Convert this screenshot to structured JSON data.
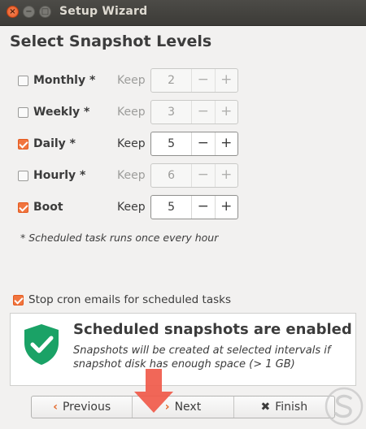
{
  "window": {
    "title": "Setup Wizard",
    "close_glyph": "×",
    "minimize_glyph": "−",
    "maximize_glyph": "□"
  },
  "page": {
    "title": "Select Snapshot Levels"
  },
  "levels": [
    {
      "label": "Monthly *",
      "checked": false,
      "keep_label": "Keep",
      "keep": "2",
      "enabled": false
    },
    {
      "label": "Weekly *",
      "checked": false,
      "keep_label": "Keep",
      "keep": "3",
      "enabled": false
    },
    {
      "label": "Daily *",
      "checked": true,
      "keep_label": "Keep",
      "keep": "5",
      "enabled": true
    },
    {
      "label": "Hourly *",
      "checked": false,
      "keep_label": "Keep",
      "keep": "6",
      "enabled": false
    },
    {
      "label": "Boot",
      "checked": true,
      "keep_label": "Keep",
      "keep": "5",
      "enabled": true
    }
  ],
  "spin_glyphs": {
    "minus": "−",
    "plus": "+"
  },
  "note": "* Scheduled task runs once every hour",
  "cron": {
    "label": "Stop cron emails for scheduled tasks",
    "checked": true
  },
  "status": {
    "title": "Scheduled snapshots are enabled",
    "description": "Snapshots will be created at selected intervals if snapshot disk has enough space (> 1 GB)",
    "icon": "shield-check-icon",
    "color": "#1aa266"
  },
  "nav": {
    "previous": {
      "icon": "‹",
      "label": "Previous"
    },
    "next": {
      "icon": "›",
      "label": "Next"
    },
    "finish": {
      "icon": "✖",
      "label": "Finish"
    }
  },
  "colors": {
    "accent": "#f1753f",
    "titlebar": "#3c3b37",
    "pointer": "#f05a4a"
  }
}
